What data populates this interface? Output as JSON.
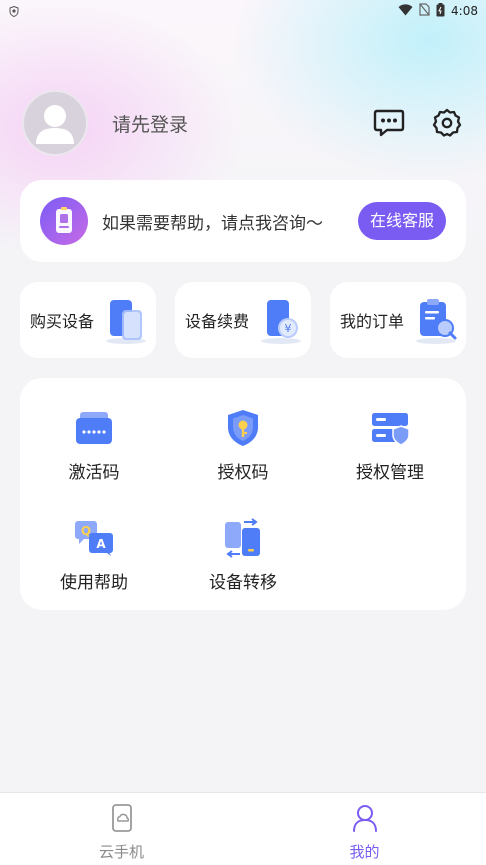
{
  "status_bar": {
    "time": "4:08"
  },
  "profile": {
    "login_text": "请先登录"
  },
  "help": {
    "text": "如果需要帮助，请点我咨询～",
    "button": "在线客服"
  },
  "quick_actions": [
    {
      "label": "购买设备",
      "icon": "phone-devices-icon"
    },
    {
      "label": "设备续费",
      "icon": "phone-yen-icon"
    },
    {
      "label": "我的订单",
      "icon": "clipboard-search-icon"
    }
  ],
  "grid": [
    {
      "label": "激活码",
      "icon": "card-icon"
    },
    {
      "label": "授权码",
      "icon": "shield-key-icon"
    },
    {
      "label": "授权管理",
      "icon": "server-shield-icon"
    },
    {
      "label": "使用帮助",
      "icon": "qa-icon"
    },
    {
      "label": "设备转移",
      "icon": "transfer-icon"
    }
  ],
  "tabs": [
    {
      "label": "云手机",
      "icon": "cloud-phone-icon",
      "active": false
    },
    {
      "label": "我的",
      "icon": "person-icon",
      "active": true
    }
  ],
  "colors": {
    "accent": "#7a5cf2",
    "icon_blue": "#4f7cf7"
  }
}
